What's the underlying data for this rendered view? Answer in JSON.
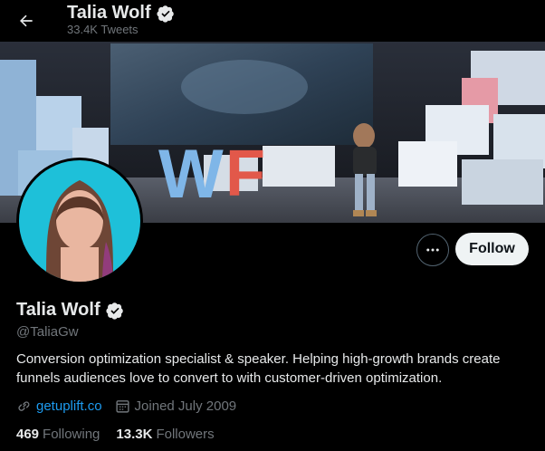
{
  "header": {
    "name": "Talia Wolf",
    "tweets_count": "33.4K Tweets",
    "back_icon": "arrow-left-icon",
    "verified_icon": "verified-badge-icon"
  },
  "banner": {
    "stage_letters": "WF"
  },
  "actions": {
    "more_icon": "more-horizontal-icon",
    "follow_label": "Follow"
  },
  "profile": {
    "name": "Talia Wolf",
    "handle": "@TaliaGw",
    "bio": "Conversion optimization specialist & speaker. Helping high-growth brands create funnels audiences love to convert to with customer-driven optimization.",
    "link_text": "getuplift.co",
    "joined": "Joined July 2009",
    "following_count": "469",
    "following_label": "Following",
    "followers_count": "13.3K",
    "followers_label": "Followers"
  },
  "colors": {
    "accent": "#1d9bf0",
    "background": "#000000",
    "text": "#e7e9ea",
    "muted": "#71767b"
  }
}
